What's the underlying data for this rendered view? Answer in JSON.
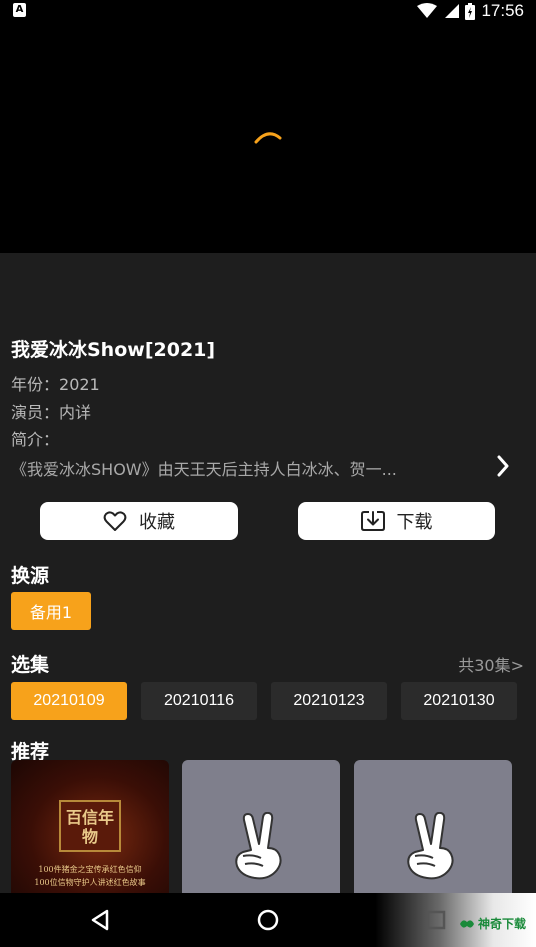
{
  "status_bar": {
    "time": "17:56",
    "notification_letter": "A"
  },
  "video": {
    "title": "我爱冰冰Show[2021]"
  },
  "info": {
    "year_label": "年份：",
    "year_value": "2021",
    "cast_label": "演员：",
    "cast_value": "内详",
    "intro_label": "简介：",
    "description": "《我爱冰冰SHOW》由天王天后主持人白冰冰、贺一..."
  },
  "actions": {
    "favorite_label": "收藏",
    "download_label": "下载"
  },
  "sources": {
    "title": "换源",
    "items": [
      "备用1"
    ]
  },
  "episodes": {
    "title": "选集",
    "total": "共30集>",
    "items": [
      "20210109",
      "20210116",
      "20210123",
      "20210130"
    ],
    "active_index": 0
  },
  "recommend": {
    "title": "推荐",
    "poster_badge": "百信年物",
    "poster_line1": "100件猪金之宝传承红色信仰",
    "poster_line2": "100位信物守护人讲述红色故事"
  },
  "watermark": {
    "text": "神奇下载"
  },
  "colors": {
    "accent": "#f7a21b",
    "background": "#1e1e1e",
    "chip": "#2b2b2b"
  }
}
